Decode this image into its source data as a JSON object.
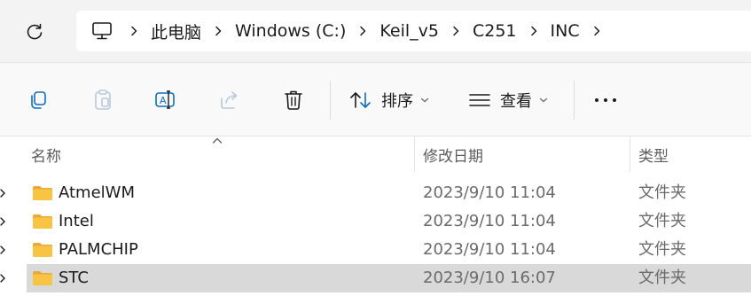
{
  "address_bar": {
    "refresh_icon": "refresh-icon",
    "root_icon": "this-pc-icon",
    "crumbs": [
      "此电脑",
      "Windows (C:)",
      "Keil_v5",
      "C251",
      "INC"
    ]
  },
  "toolbar": {
    "buttons": [
      "copy-icon",
      "paste-icon",
      "rename-icon",
      "share-icon",
      "delete-icon"
    ],
    "sort_label": "排序",
    "view_label": "查看",
    "more_icon": "more-options-icon"
  },
  "list": {
    "headers": {
      "name": "名称",
      "date": "修改日期",
      "type": "类型"
    },
    "sort_indicator": "sort-ascending-icon",
    "rows": [
      {
        "name": "AtmelWM",
        "date": "2023/9/10 11:04",
        "type": "文件夹",
        "selected": false
      },
      {
        "name": "Intel",
        "date": "2023/9/10 11:04",
        "type": "文件夹",
        "selected": false
      },
      {
        "name": "PALMCHIP",
        "date": "2023/9/10 11:04",
        "type": "文件夹",
        "selected": false
      },
      {
        "name": "STC",
        "date": "2023/9/10 16:07",
        "type": "文件夹",
        "selected": true
      }
    ]
  },
  "colors": {
    "folder_yellow": "#f7c443",
    "selected_row": "#d9d9d9",
    "accent_blue": "#0f6cbd"
  }
}
